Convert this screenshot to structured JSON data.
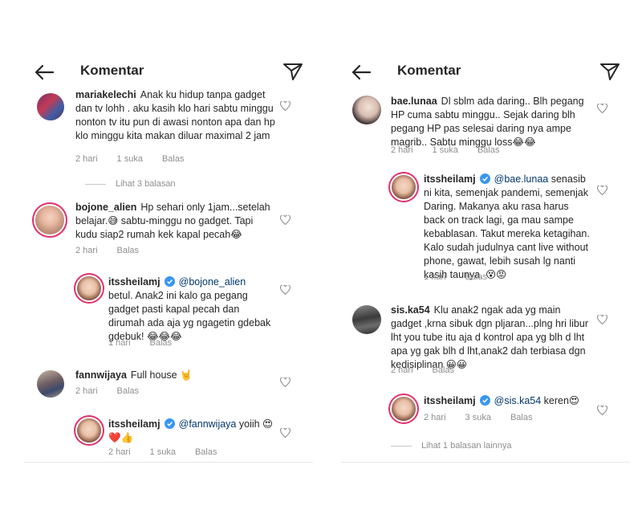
{
  "title": "Komentar",
  "left": {
    "comments": [
      {
        "user": "mariakelechi",
        "text": "Anak ku hidup tanpa gadget dan tv lohh . aku kasih klo hari sabtu minggu nonton tv itu pun di awasi nonton apa dan hp klo minggu kita makan diluar maximal 2 jam",
        "time": "2 hari",
        "likes": "1 suka",
        "reply": "Balas",
        "view_replies": "Lihat 3 balasan"
      },
      {
        "user": "bojone_alien",
        "text": "Hp sehari only 1jam...setelah belajar.😅 sabtu-minggu no gadget. Tapi kudu siap2 rumah kek kapal pecah😂",
        "time": "2 hari",
        "reply": "Balas"
      },
      {
        "user": "itssheilamj",
        "mention": "@bojone_alien",
        "text": "betul. Anak2 ini kalo ga pegang gadget pasti kapal pecah dan dirumah ada aja yg ngagetin gdebak gdebuk! 😂😂😂",
        "time": "1 hari",
        "reply": "Balas"
      },
      {
        "user": "fannwijaya",
        "text": "Full house 🤘",
        "time": "2 hari",
        "reply": "Balas"
      },
      {
        "user": "itssheilamj",
        "mention": "@fannwijaya",
        "text": "yoiih 😍❤️👍",
        "time": "2 hari",
        "likes": "1 suka",
        "reply": "Balas"
      }
    ]
  },
  "right": {
    "comments": [
      {
        "user": "bae.lunaa",
        "text": "Dl sblm ada daring.. Blh pegang HP cuma sabtu minggu.. Sejak daring blh pegang HP pas selesai daring nya ampe magrib.. Sabtu minggu loss😂😂",
        "time": "2 hari",
        "likes": "1 suka",
        "reply": "Balas"
      },
      {
        "user": "itssheilamj",
        "mention": "@bae.lunaa",
        "text": "senasib ni kita, semenjak pandemi, semenjak Daring. Makanya aku rasa harus back on track lagi, ga mau sampe kebablasan. Takut mereka ketagihan. Kalo sudah judulnya cant live without phone, gawat, lebih susah lg nanti kasih taunya. 😵😡",
        "time": "1 hari",
        "reply": "Balas"
      },
      {
        "user": "sis.ka54",
        "text": "Klu anak2 ngak ada yg main gadget ,krna sibuk dgn pljaran...plng hri libur lht you tube itu aja d kontrol apa yg blh d lht apa yg gak blh d lht,anak2 dah terbiasa dgn kedisiplinan 😀😀",
        "time": "2 hari",
        "reply": "Balas"
      },
      {
        "user": "itssheilamj",
        "mention": "@sis.ka54",
        "text": "keren😍",
        "time": "2 hari",
        "likes": "3 suka",
        "reply": "Balas",
        "view_replies": "Lihat 1 balasan lainnya"
      }
    ]
  },
  "colors": {
    "text": "#262626",
    "meta": "#8e8e8e",
    "mention": "#00376b",
    "verified": "#3897f0",
    "story_ring": "#e1306c"
  },
  "icons": {
    "back": "arrow-left-icon",
    "send": "paper-plane-icon",
    "like": "heart-outline-icon",
    "verified": "verified-badge-icon"
  }
}
